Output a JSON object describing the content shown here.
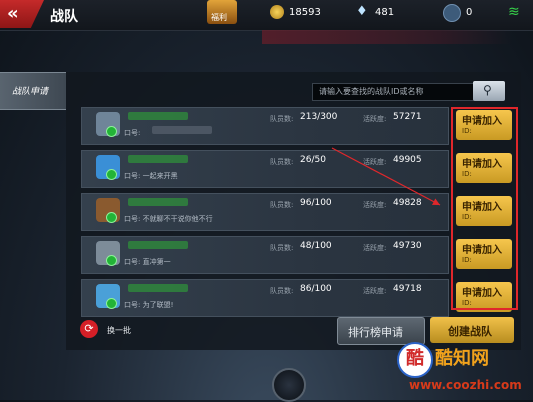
{
  "header": {
    "title": "战队",
    "welfare_label": "福利",
    "coins": "18593",
    "diamonds": "481",
    "medals": "0"
  },
  "sidebar": {
    "tab_label": "战队申请"
  },
  "search": {
    "placeholder": "请输入要查找的战队ID或名称"
  },
  "labels": {
    "members": "队员数:",
    "activity": "活跃度:",
    "motto_prefix": "口号:",
    "join": "申请加入",
    "join_sub": "ID:"
  },
  "teams": [
    {
      "members": "213/300",
      "activity": "57271",
      "motto": "口号: ",
      "badge_color": "#6f8599"
    },
    {
      "members": "26/50",
      "activity": "49905",
      "motto": "口号: 一起来开黑",
      "badge_color": "#3a8fd6"
    },
    {
      "members": "96/100",
      "activity": "49828",
      "motto": "口号: 不就聊不干说你他不行",
      "badge_color": "#8a5a2f"
    },
    {
      "members": "48/100",
      "activity": "49730",
      "motto": "口号: 直冲第一",
      "badge_color": "#7d8c99"
    },
    {
      "members": "86/100",
      "activity": "49718",
      "motto": "口号: 为了联盟!",
      "badge_color": "#4aa0d8"
    }
  ],
  "footer": {
    "refresh": "换一批",
    "rank_apply": "排行榜申请",
    "create_team": "创建战队"
  },
  "watermark": {
    "logo": "酷",
    "name": "酷知网",
    "url": "www.coozhi.com"
  },
  "colors": {
    "accent_red": "#e0272b",
    "join_gold": "#f1c14a"
  }
}
